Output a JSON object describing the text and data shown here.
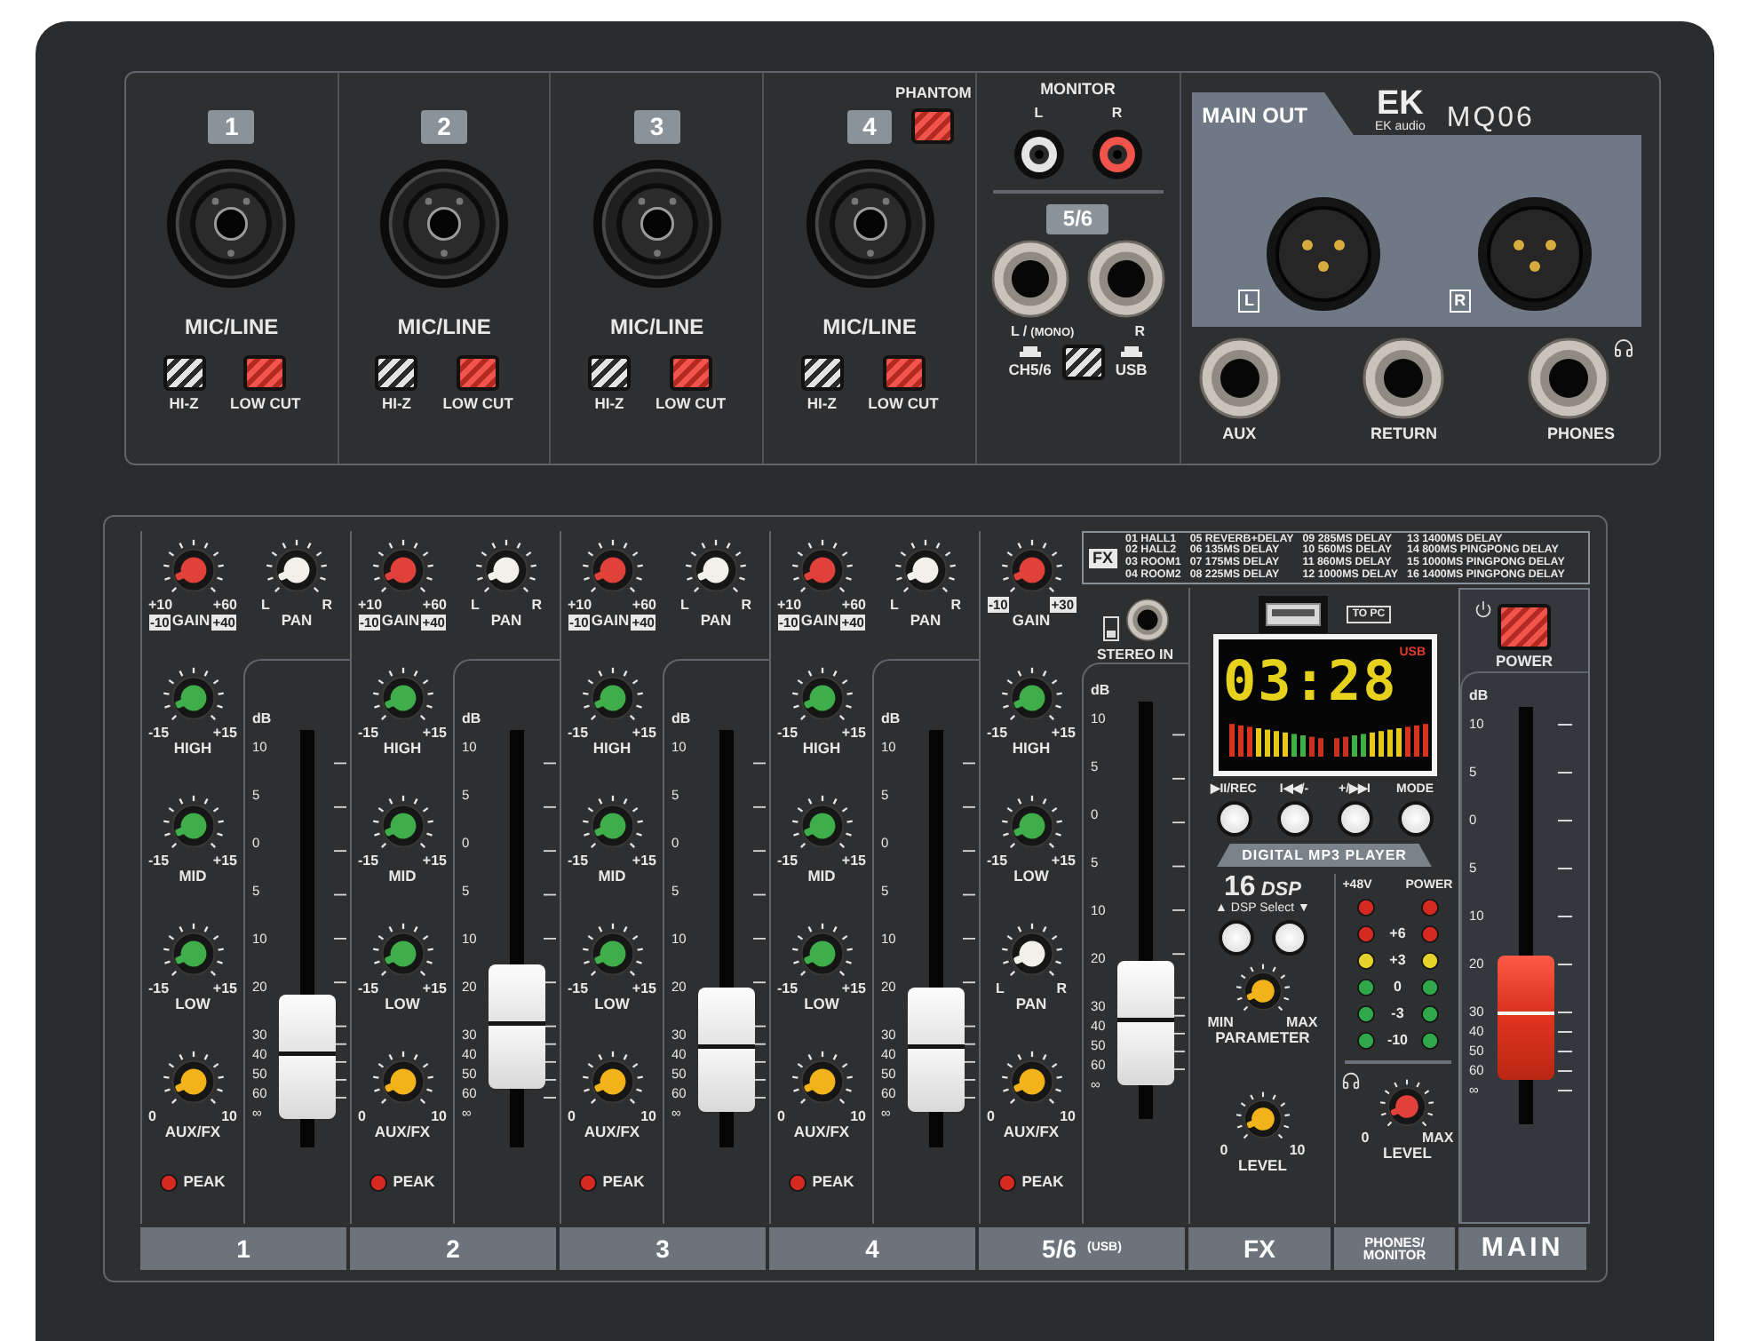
{
  "top_panel": {
    "mic_channels": [
      {
        "number": "1",
        "jack_label": "MIC/LINE",
        "switches": [
          {
            "label": "HI-Z",
            "kind": "plain",
            "on": false
          },
          {
            "label": "LOW CUT",
            "kind": "accent",
            "on": false
          }
        ]
      },
      {
        "number": "2",
        "jack_label": "MIC/LINE",
        "switches": [
          {
            "label": "HI-Z",
            "kind": "plain",
            "on": false
          },
          {
            "label": "LOW CUT",
            "kind": "accent",
            "on": false
          }
        ]
      },
      {
        "number": "3",
        "jack_label": "MIC/LINE",
        "switches": [
          {
            "label": "HI-Z",
            "kind": "plain",
            "on": false
          },
          {
            "label": "LOW CUT",
            "kind": "accent",
            "on": false
          }
        ]
      },
      {
        "number": "4",
        "phantom": {
          "label": "PHANTOM",
          "kind": "accent",
          "on": false
        },
        "jack_label": "MIC/LINE",
        "switches": [
          {
            "label": "HI-Z",
            "kind": "plain",
            "on": false
          },
          {
            "label": "LOW CUT",
            "kind": "accent",
            "on": false
          }
        ]
      }
    ],
    "stereo_inputs": {
      "monitor_label": "MONITOR",
      "rca": [
        {
          "label": "L",
          "kind": "plain"
        },
        {
          "label": "R",
          "kind": "accent"
        }
      ],
      "number": "5/6",
      "jacks": [
        {
          "label": "L /",
          "note": "(MONO)"
        },
        {
          "label": "R"
        }
      ],
      "source_switch": {
        "left": "CH5/6",
        "right": "USB",
        "on": false
      }
    },
    "main_out": {
      "label": "MAIN OUT",
      "logo": "EK",
      "brand": "EK audio",
      "model": "MQ06",
      "outputs": [
        {
          "label": "L"
        },
        {
          "label": "R"
        }
      ],
      "jacks": [
        {
          "label": "AUX"
        },
        {
          "label": "RETURN"
        },
        {
          "label": "PHONES"
        }
      ]
    }
  },
  "mixer": {
    "fx_list": {
      "title": "FX",
      "presets": [
        "01 HALL1",
        "02 HALL2",
        "03 ROOM1",
        "04 ROOM2",
        "05 REVERB+DELAY",
        "06 135MS DELAY",
        "07 175MS DELAY",
        "08 225MS DELAY",
        "09 285MS DELAY",
        "10 560MS DELAY",
        "11 860MS DELAY",
        "12 1000MS DELAY",
        "13 1400MS DELAY",
        "14 800MS PINGPONG DELAY",
        "15 1000MS PINGPONG DELAY",
        "16 1400MS PINGPONG DELAY"
      ]
    },
    "channels": [
      {
        "name": "1",
        "gain": {
          "label": "GAIN",
          "min": "-10",
          "max": "+40",
          "min_alt": "+10",
          "max_alt": "+60"
        },
        "pan": {
          "label": "PAN",
          "min": "L",
          "max": "R"
        },
        "eq": [
          {
            "label": "HIGH",
            "min": "-15",
            "max": "+15"
          },
          {
            "label": "MID",
            "min": "-15",
            "max": "+15"
          },
          {
            "label": "LOW",
            "min": "-15",
            "max": "+15"
          }
        ],
        "aux": {
          "label": "AUX/FX",
          "min": "0",
          "max": "10"
        },
        "peak": "PEAK",
        "fader": {
          "unit": "dB",
          "scale": [
            "10",
            "5",
            "0",
            "5",
            "10",
            "20",
            "30",
            "40",
            "50",
            "60",
            "∞"
          ],
          "level": 0.1
        }
      },
      {
        "name": "2",
        "gain": {
          "label": "GAIN",
          "min": "-10",
          "max": "+40",
          "min_alt": "+10",
          "max_alt": "+60"
        },
        "pan": {
          "label": "PAN",
          "min": "L",
          "max": "R"
        },
        "eq": [
          {
            "label": "HIGH",
            "min": "-15",
            "max": "+15"
          },
          {
            "label": "MID",
            "min": "-15",
            "max": "+15"
          },
          {
            "label": "LOW",
            "min": "-15",
            "max": "+15"
          }
        ],
        "aux": {
          "label": "AUX/FX",
          "min": "0",
          "max": "10"
        },
        "peak": "PEAK",
        "fader": {
          "unit": "dB",
          "scale": [
            "10",
            "5",
            "0",
            "5",
            "10",
            "20",
            "30",
            "40",
            "50",
            "60",
            "∞"
          ],
          "level": 0.2
        }
      },
      {
        "name": "3",
        "gain": {
          "label": "GAIN",
          "min": "-10",
          "max": "+40",
          "min_alt": "+10",
          "max_alt": "+60"
        },
        "pan": {
          "label": "PAN",
          "min": "L",
          "max": "R"
        },
        "eq": [
          {
            "label": "HIGH",
            "min": "-15",
            "max": "+15"
          },
          {
            "label": "MID",
            "min": "-15",
            "max": "+15"
          },
          {
            "label": "LOW",
            "min": "-15",
            "max": "+15"
          }
        ],
        "aux": {
          "label": "AUX/FX",
          "min": "0",
          "max": "10"
        },
        "peak": "PEAK",
        "fader": {
          "unit": "dB",
          "scale": [
            "10",
            "5",
            "0",
            "5",
            "10",
            "20",
            "30",
            "40",
            "50",
            "60",
            "∞"
          ],
          "level": 0.12
        }
      },
      {
        "name": "4",
        "gain": {
          "label": "GAIN",
          "min": "-10",
          "max": "+40",
          "min_alt": "+10",
          "max_alt": "+60"
        },
        "pan": {
          "label": "PAN",
          "min": "L",
          "max": "R"
        },
        "eq": [
          {
            "label": "HIGH",
            "min": "-15",
            "max": "+15"
          },
          {
            "label": "MID",
            "min": "-15",
            "max": "+15"
          },
          {
            "label": "LOW",
            "min": "-15",
            "max": "+15"
          }
        ],
        "aux": {
          "label": "AUX/FX",
          "min": "0",
          "max": "10"
        },
        "peak": "PEAK",
        "fader": {
          "unit": "dB",
          "scale": [
            "10",
            "5",
            "0",
            "5",
            "10",
            "20",
            "30",
            "40",
            "50",
            "60",
            "∞"
          ],
          "level": 0.12
        }
      }
    ],
    "stereo_channel": {
      "name": "5/6",
      "name_note": "(USB)",
      "gain": {
        "label": "GAIN",
        "min": "-10",
        "max": "+30"
      },
      "stereo_in": "STEREO IN",
      "eq": [
        {
          "label": "HIGH",
          "min": "-15",
          "max": "+15"
        },
        {
          "label": "LOW",
          "min": "-15",
          "max": "+15"
        }
      ],
      "pan": {
        "label": "PAN",
        "min": "L",
        "max": "R"
      },
      "aux": {
        "label": "AUX/FX",
        "min": "0",
        "max": "10"
      },
      "peak": "PEAK",
      "fader": {
        "unit": "dB",
        "scale": [
          "10",
          "5",
          "0",
          "5",
          "10",
          "20",
          "30",
          "40",
          "50",
          "60",
          "∞"
        ],
        "level": 0.12
      }
    },
    "mp3_player": {
      "port_label": "TO PC",
      "display": {
        "time": "03:28",
        "source": "USB"
      },
      "buttons": [
        {
          "label": "▶II/REC"
        },
        {
          "label": "I◀◀/-"
        },
        {
          "label": "+/▶▶I"
        },
        {
          "label": "MODE"
        }
      ],
      "title": "DIGITAL MP3 PLAYER"
    },
    "dsp": {
      "name": "FX",
      "count": "16",
      "label": "DSP",
      "select_label": "▲ DSP Select ▼",
      "parameter": {
        "label": "PARAMETER",
        "min": "MIN",
        "max": "MAX"
      },
      "level_knob": {
        "label": "LEVEL",
        "min": "0",
        "max": "10"
      }
    },
    "meter": {
      "indicators": [
        {
          "label": "+48V",
          "color": "#d42a22"
        },
        {
          "label": "POWER",
          "color": "#d42a22"
        }
      ],
      "rows": [
        {
          "label": "+6",
          "color": "#d42a22"
        },
        {
          "label": "+3",
          "color": "#e3d32a"
        },
        {
          "label": "0",
          "color": "#2fa84a"
        },
        {
          "label": "-3",
          "color": "#2fa84a"
        },
        {
          "label": "-10",
          "color": "#2fa84a"
        }
      ]
    },
    "phones": {
      "name": "PHONES/ MONITOR",
      "level_knob": {
        "label": "LEVEL",
        "min": "0",
        "max": "MAX"
      }
    },
    "main": {
      "name": "MAIN",
      "power_label": "POWER",
      "power_on": false,
      "fader": {
        "unit": "dB",
        "scale": [
          "10",
          "5",
          "0",
          "5",
          "10",
          "20",
          "30",
          "40",
          "50",
          "60",
          "∞"
        ],
        "level": 0.15
      }
    }
  }
}
